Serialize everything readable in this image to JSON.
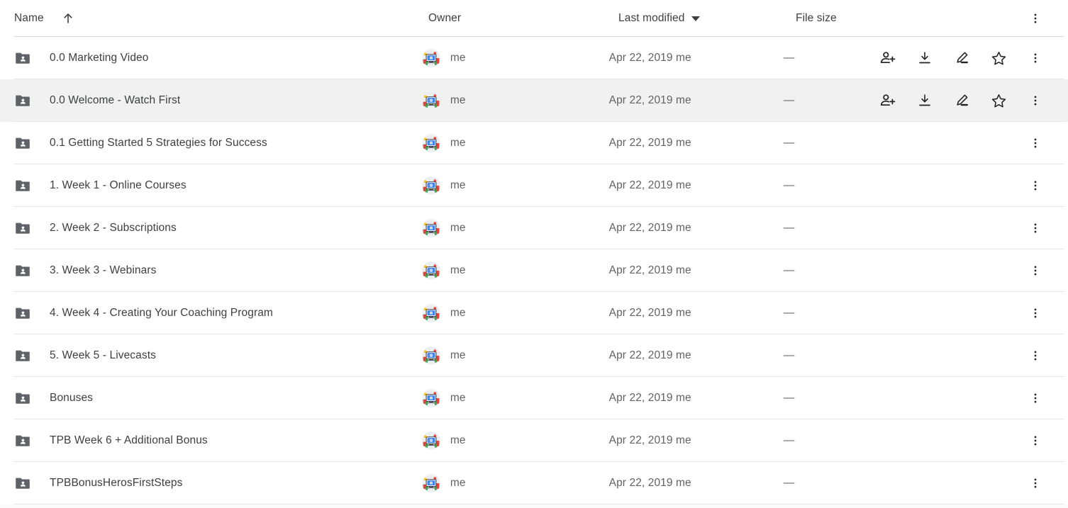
{
  "columns": {
    "name": "Name",
    "owner": "Owner",
    "last_modified": "Last modified",
    "file_size": "File size",
    "sort_icon": "arrow-up-icon",
    "sort_direction": "ascending",
    "modified_caret_icon": "caret-down-icon",
    "header_more_icon": "more-vertical-icon"
  },
  "colors": {
    "row_selected_bg": "#f0f1f1",
    "row_bg": "#ffffff",
    "divider": "#e3e4e6",
    "header_divider": "#dadce0",
    "text_primary": "#3c4043",
    "text_secondary": "#5f6368",
    "folder_icon": "#5f6368"
  },
  "row_actions": {
    "share_label": "share-person-add-icon",
    "download_label": "download-icon",
    "edit_label": "edit-pencil-icon",
    "star_label": "star-icon",
    "more_label": "more-vertical-icon"
  },
  "files": [
    {
      "name": "0.0 Marketing Video",
      "icon": "shared-folder-icon",
      "owner": "me",
      "modified": "Apr 22, 2019 me",
      "size": "—",
      "selected": false,
      "show_actions": true
    },
    {
      "name": "0.0 Welcome -  Watch First",
      "icon": "shared-folder-icon",
      "owner": "me",
      "modified": "Apr 22, 2019 me",
      "size": "—",
      "selected": true,
      "show_actions": true
    },
    {
      "name": "0.1 Getting Started 5 Strategies for Success",
      "icon": "shared-folder-icon",
      "owner": "me",
      "modified": "Apr 22, 2019 me",
      "size": "—",
      "selected": false,
      "show_actions": false
    },
    {
      "name": "1. Week 1 - Online Courses",
      "icon": "shared-folder-icon",
      "owner": "me",
      "modified": "Apr 22, 2019 me",
      "size": "—",
      "selected": false,
      "show_actions": false
    },
    {
      "name": "2. Week 2 - Subscriptions",
      "icon": "shared-folder-icon",
      "owner": "me",
      "modified": "Apr 22, 2019 me",
      "size": "—",
      "selected": false,
      "show_actions": false
    },
    {
      "name": "3. Week 3 - Webinars",
      "icon": "shared-folder-icon",
      "owner": "me",
      "modified": "Apr 22, 2019 me",
      "size": "—",
      "selected": false,
      "show_actions": false
    },
    {
      "name": "4. Week 4 - Creating Your Coaching Program",
      "icon": "shared-folder-icon",
      "owner": "me",
      "modified": "Apr 22, 2019 me",
      "size": "—",
      "selected": false,
      "show_actions": false
    },
    {
      "name": "5. Week 5 - Livecasts",
      "icon": "shared-folder-icon",
      "owner": "me",
      "modified": "Apr 22, 2019 me",
      "size": "—",
      "selected": false,
      "show_actions": false
    },
    {
      "name": "Bonuses",
      "icon": "shared-folder-icon",
      "owner": "me",
      "modified": "Apr 22, 2019 me",
      "size": "—",
      "selected": false,
      "show_actions": false
    },
    {
      "name": "TPB Week 6 + Additional Bonus",
      "icon": "shared-folder-icon",
      "owner": "me",
      "modified": "Apr 22, 2019 me",
      "size": "—",
      "selected": false,
      "show_actions": false
    },
    {
      "name": "TPBBonusHerosFirstSteps",
      "icon": "shared-folder-icon",
      "owner": "me",
      "modified": "Apr 22, 2019 me",
      "size": "—",
      "selected": false,
      "show_actions": false
    }
  ]
}
